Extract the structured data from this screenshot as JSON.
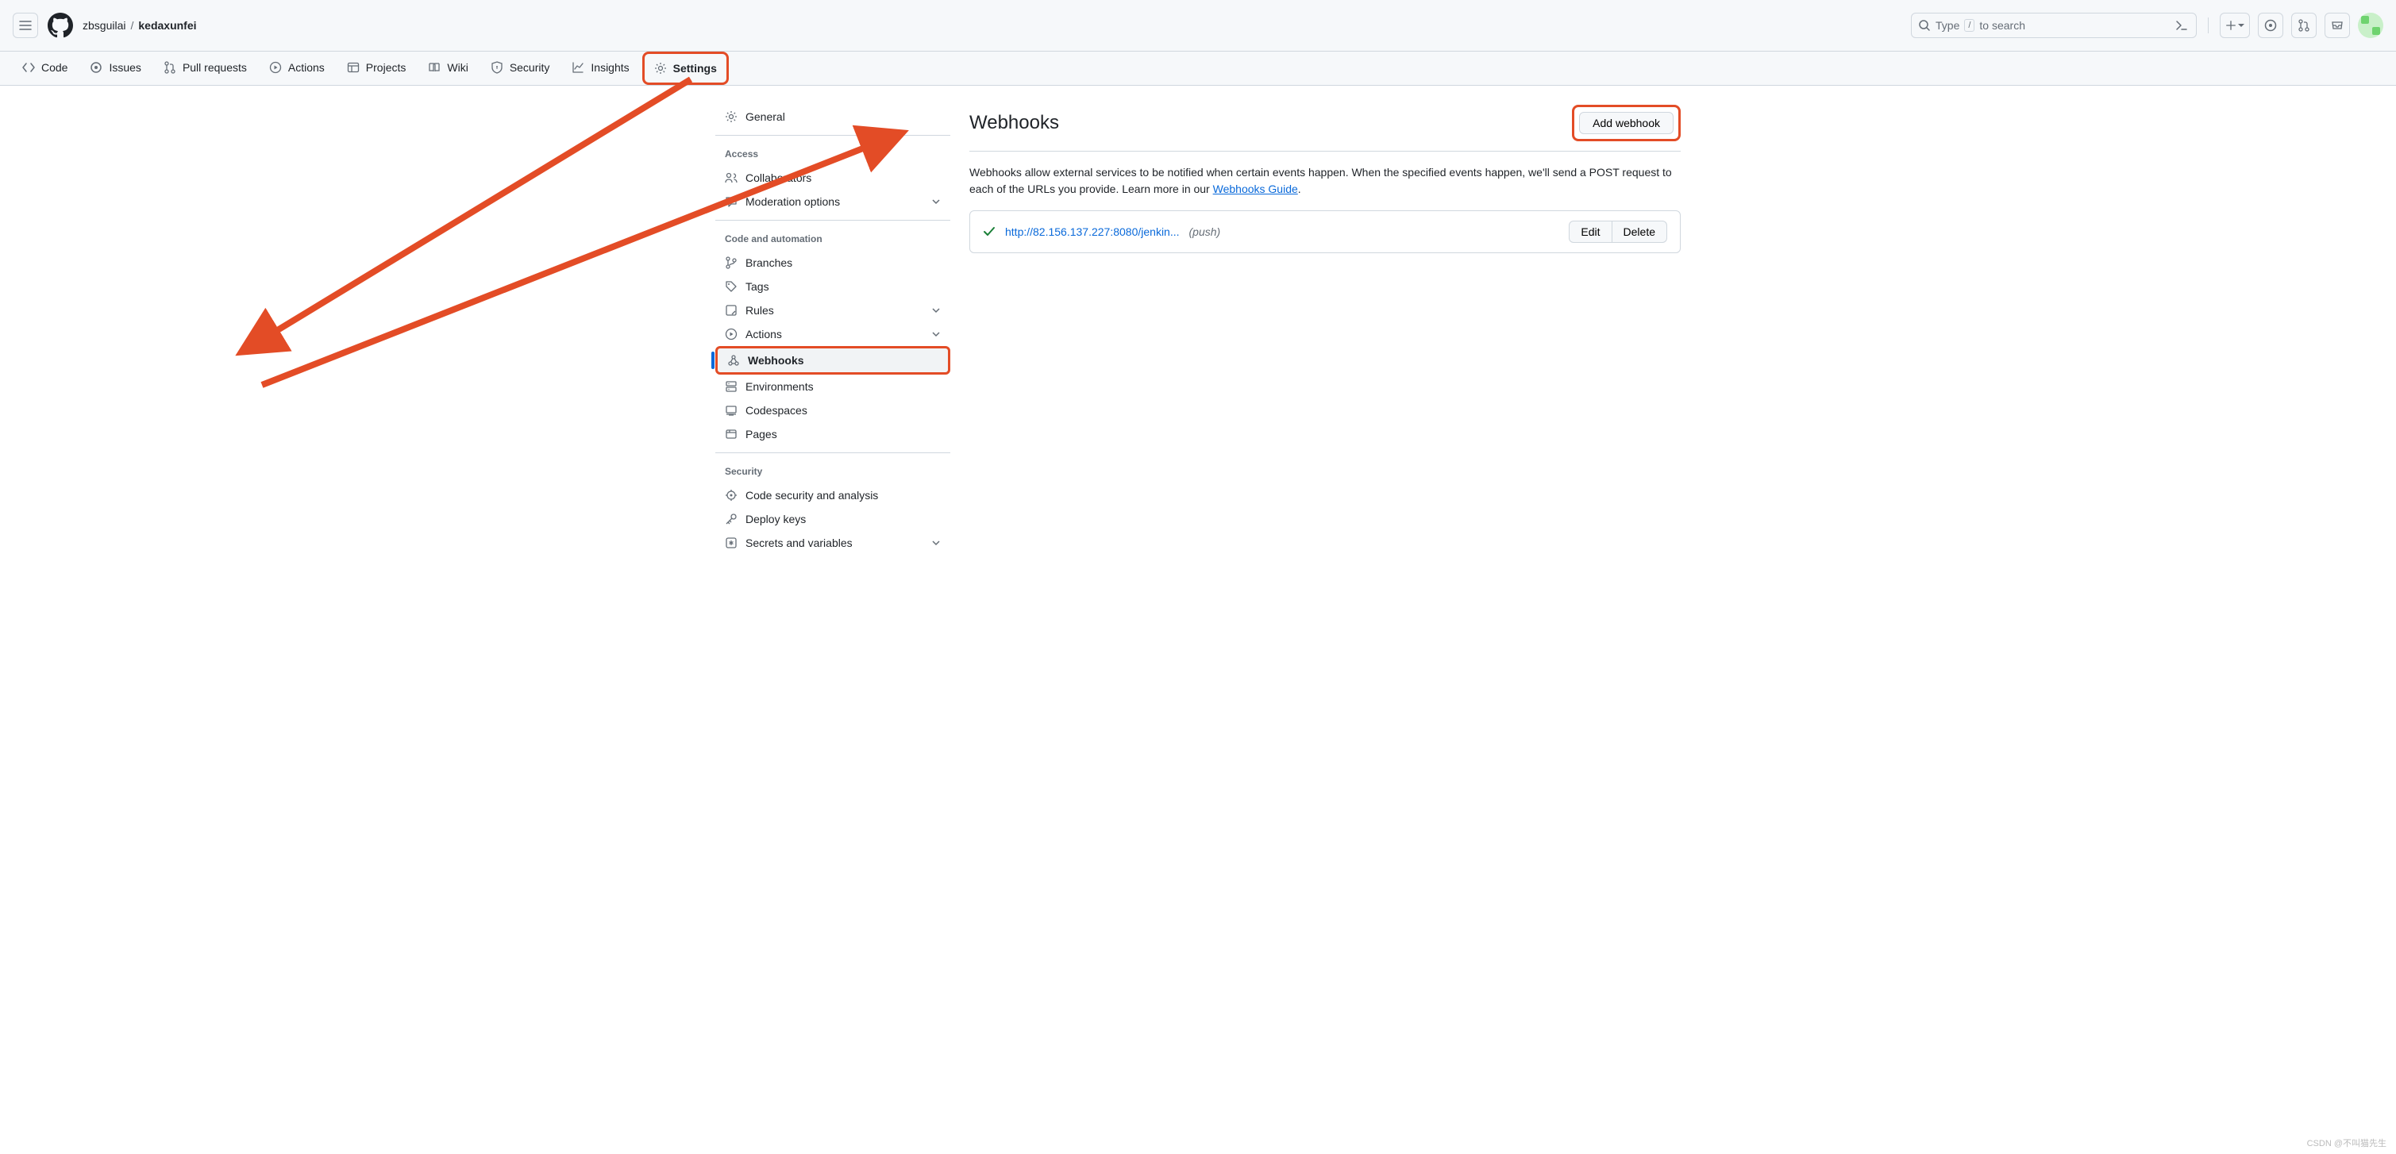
{
  "header": {
    "owner": "zbsguilai",
    "sep": "/",
    "repo": "kedaxunfei",
    "search_prefix": "Type",
    "search_slash": "/",
    "search_suffix": "to search"
  },
  "repo_nav": [
    {
      "label": "Code",
      "icon": "code"
    },
    {
      "label": "Issues",
      "icon": "issue"
    },
    {
      "label": "Pull requests",
      "icon": "pr"
    },
    {
      "label": "Actions",
      "icon": "play"
    },
    {
      "label": "Projects",
      "icon": "project"
    },
    {
      "label": "Wiki",
      "icon": "book"
    },
    {
      "label": "Security",
      "icon": "shield"
    },
    {
      "label": "Insights",
      "icon": "graph"
    },
    {
      "label": "Settings",
      "icon": "gear",
      "current": true
    }
  ],
  "sidebar": {
    "general": "General",
    "groups": [
      {
        "heading": "Access",
        "items": [
          {
            "label": "Collaborators",
            "icon": "people"
          },
          {
            "label": "Moderation options",
            "icon": "comment",
            "chevron": true
          }
        ]
      },
      {
        "heading": "Code and automation",
        "items": [
          {
            "label": "Branches",
            "icon": "branch"
          },
          {
            "label": "Tags",
            "icon": "tag"
          },
          {
            "label": "Rules",
            "icon": "rules",
            "chevron": true
          },
          {
            "label": "Actions",
            "icon": "play",
            "chevron": true
          },
          {
            "label": "Webhooks",
            "icon": "webhook",
            "active": true
          },
          {
            "label": "Environments",
            "icon": "env"
          },
          {
            "label": "Codespaces",
            "icon": "codespaces"
          },
          {
            "label": "Pages",
            "icon": "pages"
          }
        ]
      },
      {
        "heading": "Security",
        "items": [
          {
            "label": "Code security and analysis",
            "icon": "scan"
          },
          {
            "label": "Deploy keys",
            "icon": "key"
          },
          {
            "label": "Secrets and variables",
            "icon": "secret",
            "chevron": true
          }
        ]
      }
    ]
  },
  "main": {
    "title": "Webhooks",
    "add_button": "Add webhook",
    "description_1": "Webhooks allow external services to be notified when certain events happen. When the specified events happen, we'll send a POST request to each of the URLs you provide. Learn more in our ",
    "description_link": "Webhooks Guide",
    "description_2": ".",
    "hooks": [
      {
        "url": "http://82.156.137.227:8080/jenkin...",
        "meta": "(push)",
        "edit": "Edit",
        "delete": "Delete"
      }
    ]
  },
  "watermark": "CSDN @不叫猫先生"
}
